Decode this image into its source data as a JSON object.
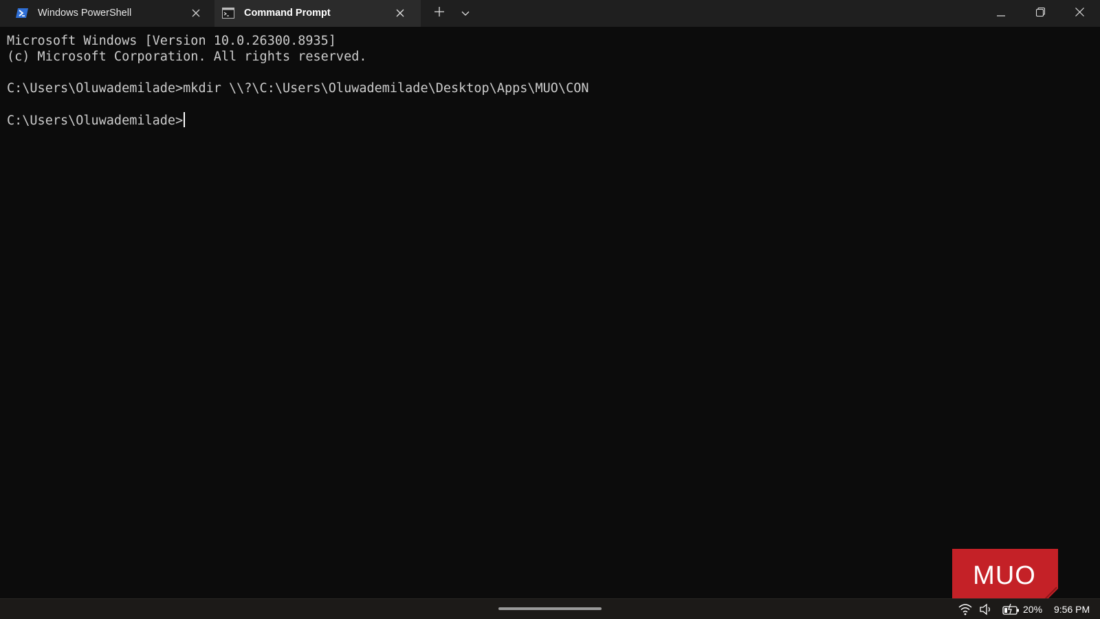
{
  "tabs": [
    {
      "label": "Windows PowerShell",
      "icon": "powershell-icon",
      "active": false
    },
    {
      "label": "Command Prompt",
      "icon": "command-prompt-icon",
      "active": true
    }
  ],
  "terminal": {
    "lines": [
      "Microsoft Windows [Version 10.0.26300.8935]",
      "(c) Microsoft Corporation. All rights reserved.",
      "C:\\Users\\Oluwademilade>mkdir \\\\?\\C:\\Users\\Oluwademilade\\Desktop\\Apps\\MUO\\CON",
      "C:\\Users\\Oluwademilade>"
    ]
  },
  "watermark": {
    "text": "MUO",
    "color": "#c42127"
  },
  "tray": {
    "battery_percent": "20%",
    "time": "9:56 PM"
  },
  "colors": {
    "titlebar": "#1f1f1f",
    "active_tab": "#2b2b2b",
    "terminal_bg": "#0c0c0c",
    "terminal_text": "#cccccc",
    "powershell_blue": "#2f6fd6"
  }
}
